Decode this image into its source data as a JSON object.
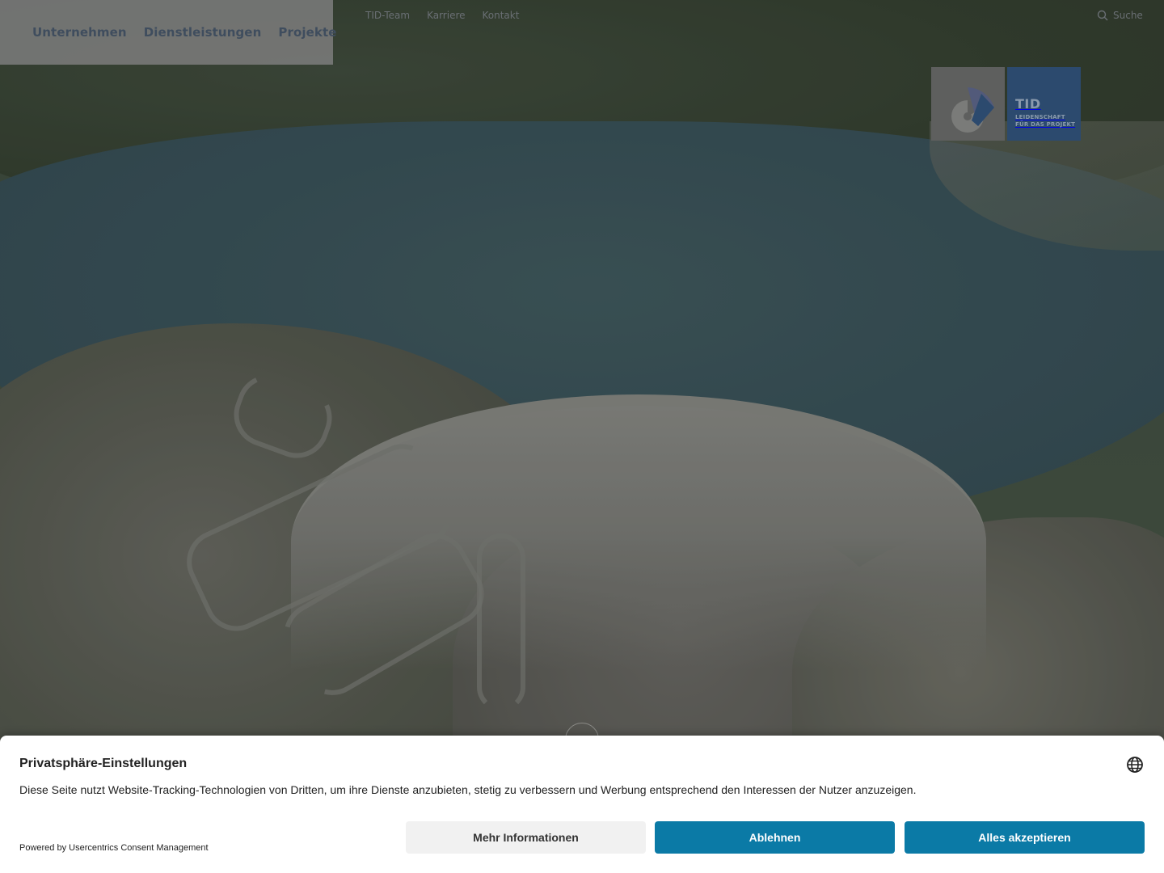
{
  "colors": {
    "nav_text": "#3f4d5e",
    "logo_blue": "#2c4a6e",
    "accent_button": "#0b7aa6",
    "secondary_button": "#f1f1f1"
  },
  "nav": {
    "main": [
      "Unternehmen",
      "Dienstleistungen",
      "Projekte"
    ],
    "meta": [
      "TID-Team",
      "Karriere",
      "Kontakt"
    ],
    "search_label": "Suche",
    "search_icon": "search-icon"
  },
  "logo": {
    "name": "TID",
    "claim_line1": "LEIDENSCHAFT",
    "claim_line2": "FÜR DAS PROJEKT"
  },
  "consent": {
    "title": "Privatsphäre-Einstellungen",
    "text": "Diese Seite nutzt Website-Tracking-Technologien von Dritten, um ihre Dienste anzubieten, stetig zu verbessern und Werbung entsprechend den Interessen der Nutzer anzuzeigen.",
    "powered_by": "Powered by Usercentrics Consent Management",
    "buttons": {
      "more": "Mehr Informationen",
      "deny": "Ablehnen",
      "accept": "Alles akzeptieren"
    },
    "language_icon": "globe-icon"
  }
}
